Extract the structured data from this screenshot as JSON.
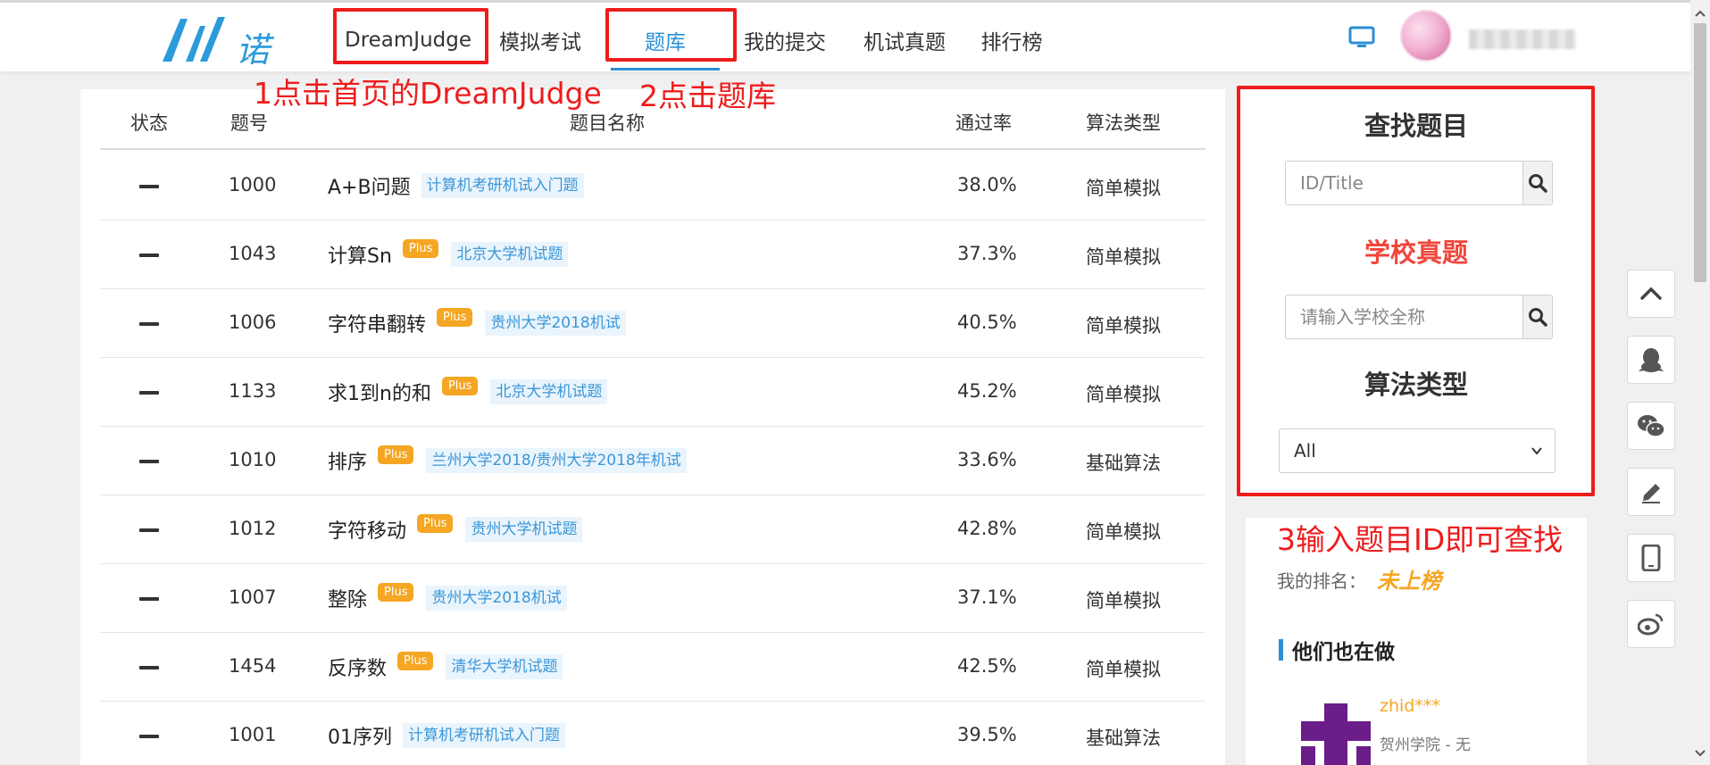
{
  "logo": {
    "text": "诺",
    "icon": "dreamjudge-logo"
  },
  "nav": {
    "items": [
      {
        "label": "DreamJudge"
      },
      {
        "label": "模拟考试"
      },
      {
        "label": "题库"
      },
      {
        "label": "我的提交"
      },
      {
        "label": "机试真题"
      },
      {
        "label": "排行榜"
      }
    ],
    "active_index": 2
  },
  "header": {
    "device_icon": "monitor-icon"
  },
  "table": {
    "headers": [
      "状态",
      "题号",
      "题目名称",
      "通过率",
      "算法类型"
    ],
    "rows": [
      {
        "status": "—",
        "id": "1000",
        "title": "A+B问题",
        "plus": "",
        "tag": "计算机考研机试入门题",
        "rate": "38.0%",
        "type": "简单模拟"
      },
      {
        "status": "—",
        "id": "1043",
        "title": "计算Sn",
        "plus": "Plus",
        "tag": "北京大学机试题",
        "rate": "37.3%",
        "type": "简单模拟"
      },
      {
        "status": "—",
        "id": "1006",
        "title": "字符串翻转",
        "plus": "Plus",
        "tag": "贵州大学2018机试",
        "rate": "40.5%",
        "type": "简单模拟"
      },
      {
        "status": "—",
        "id": "1133",
        "title": "求1到n的和",
        "plus": "Plus",
        "tag": "北京大学机试题",
        "rate": "45.2%",
        "type": "简单模拟"
      },
      {
        "status": "—",
        "id": "1010",
        "title": "排序",
        "plus": "Plus",
        "tag": "兰州大学2018/贵州大学2018年机试",
        "rate": "33.6%",
        "type": "基础算法"
      },
      {
        "status": "—",
        "id": "1012",
        "title": "字符移动",
        "plus": "Plus",
        "tag": "贵州大学机试题",
        "rate": "42.8%",
        "type": "简单模拟"
      },
      {
        "status": "—",
        "id": "1007",
        "title": "整除",
        "plus": "Plus",
        "tag": "贵州大学2018机试",
        "rate": "37.1%",
        "type": "简单模拟"
      },
      {
        "status": "—",
        "id": "1454",
        "title": "反序数",
        "plus": "Plus",
        "tag": "清华大学机试题",
        "rate": "42.5%",
        "type": "简单模拟"
      },
      {
        "status": "—",
        "id": "1001",
        "title": "01序列",
        "plus": "",
        "tag": "计算机考研机试入门题",
        "rate": "39.5%",
        "type": "基础算法"
      }
    ]
  },
  "sidebar": {
    "find_title": "查找题目",
    "find_placeholder": "ID/Title",
    "school_title": "学校真题",
    "school_placeholder": "请输入学校全称",
    "algo_title": "算法类型",
    "algo_selected": "All",
    "my_rank_label": "我的排名：",
    "my_rank_value": "未上榜",
    "also_title": "他们也在做",
    "also_user_name": "zhid***",
    "also_user_school": "贺州学院 - 无"
  },
  "tools": [
    "chevron-up-icon",
    "qq-icon",
    "wechat-icon",
    "edit-icon",
    "mobile-icon",
    "weibo-icon"
  ],
  "annotations": {
    "note1": "1点击首页的DreamJudge",
    "note2": "2点击题库",
    "note3": "3输入题目ID即可查找"
  },
  "colors": {
    "accent": "#2b8fd6",
    "plus_badge": "#f5a623",
    "annotation_red": "#ee1c1c",
    "tag_text": "#3a97d8",
    "tag_bg": "#eaf4fc"
  }
}
